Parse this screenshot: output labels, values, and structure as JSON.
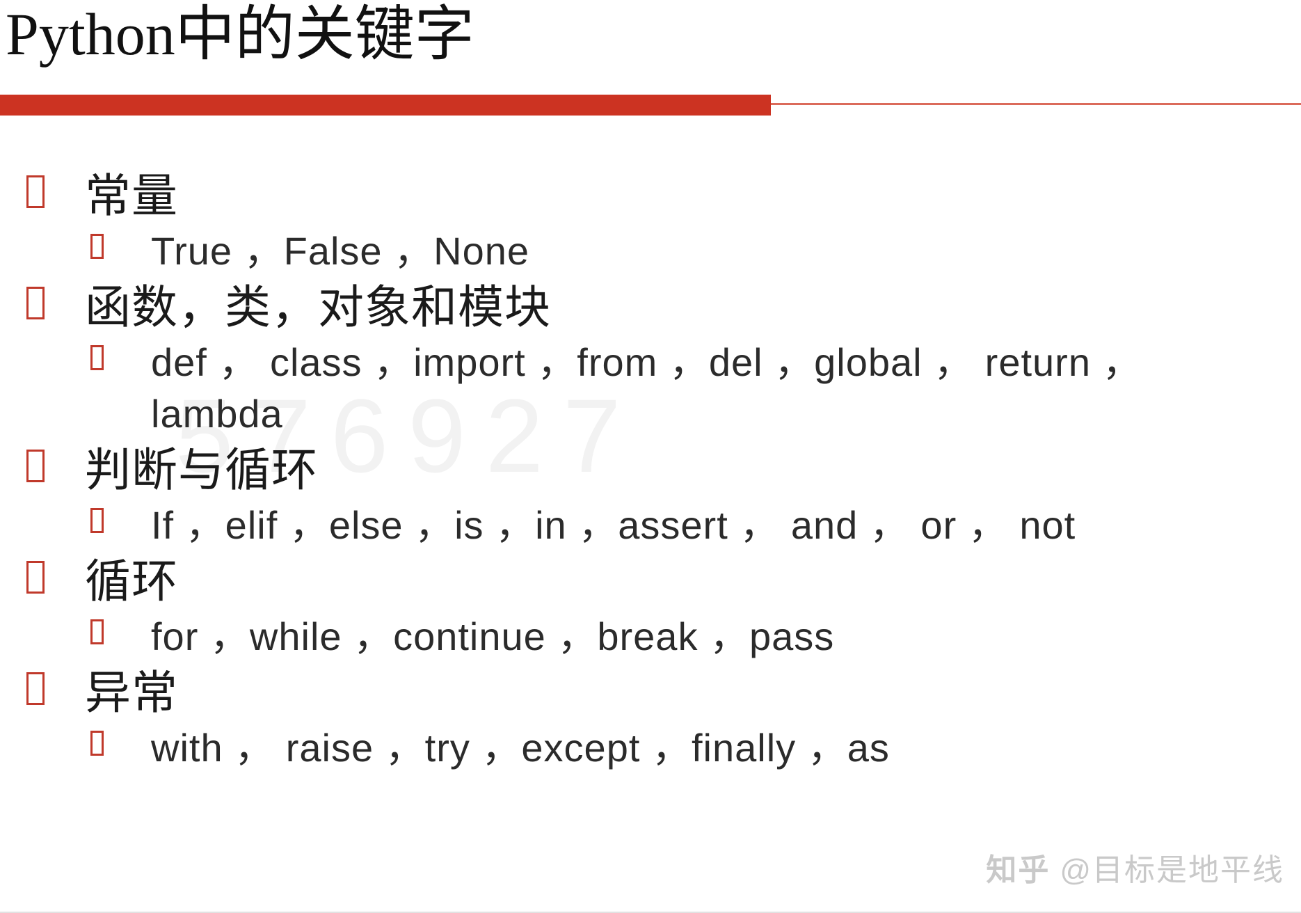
{
  "slide": {
    "title": "Python中的关键字",
    "accent_color": "#cc3322",
    "bullet_color": "#c0392b",
    "background": "#ffffff"
  },
  "watermarks": {
    "number": "576927",
    "brand_site": "知乎",
    "brand_user": "@目标是地平线"
  },
  "outline": [
    {
      "heading": "常量",
      "items": [
        "True ，False ，None"
      ]
    },
    {
      "heading": "函数，类，对象和模块",
      "items": [
        "def ， class ，import ，from ，del ，global ， return ，",
        "lambda"
      ]
    },
    {
      "heading": "判断与循环",
      "items": [
        "If ，elif ，else ，is ，in ，assert ， and ， or ， not"
      ]
    },
    {
      "heading": "循环",
      "items": [
        "for ，while ，continue ，break ，pass"
      ]
    },
    {
      "heading": "异常",
      "items": [
        "with ， raise ，try ，except ，finally ，as"
      ]
    }
  ]
}
